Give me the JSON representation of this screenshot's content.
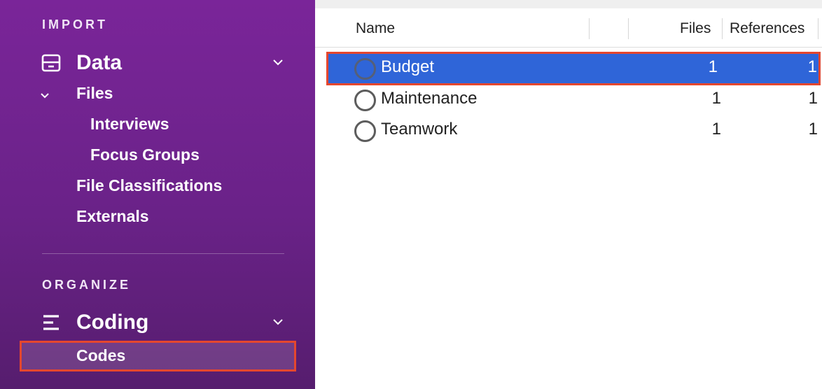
{
  "sidebar": {
    "import_header": "IMPORT",
    "data_group": {
      "label": "Data",
      "icon": "data-drawer-icon",
      "files_label": "Files",
      "files_children": [
        "Interviews",
        "Focus Groups"
      ],
      "file_classifications_label": "File Classifications",
      "externals_label": "Externals"
    },
    "organize_header": "ORGANIZE",
    "coding_group": {
      "label": "Coding",
      "icon": "coding-lines-icon",
      "codes_label": "Codes"
    }
  },
  "table": {
    "columns": {
      "name": "Name",
      "files": "Files",
      "references": "References"
    },
    "rows": [
      {
        "name": "Budget",
        "files": "1",
        "references": "1",
        "selected": true
      },
      {
        "name": "Maintenance",
        "files": "1",
        "references": "1",
        "selected": false
      },
      {
        "name": "Teamwork",
        "files": "1",
        "references": "1",
        "selected": false
      }
    ]
  },
  "colors": {
    "sidebar_top": "#7a2599",
    "sidebar_bottom": "#561d6e",
    "selection_blue": "#2f65d8",
    "highlight_outline": "#e5472e"
  }
}
